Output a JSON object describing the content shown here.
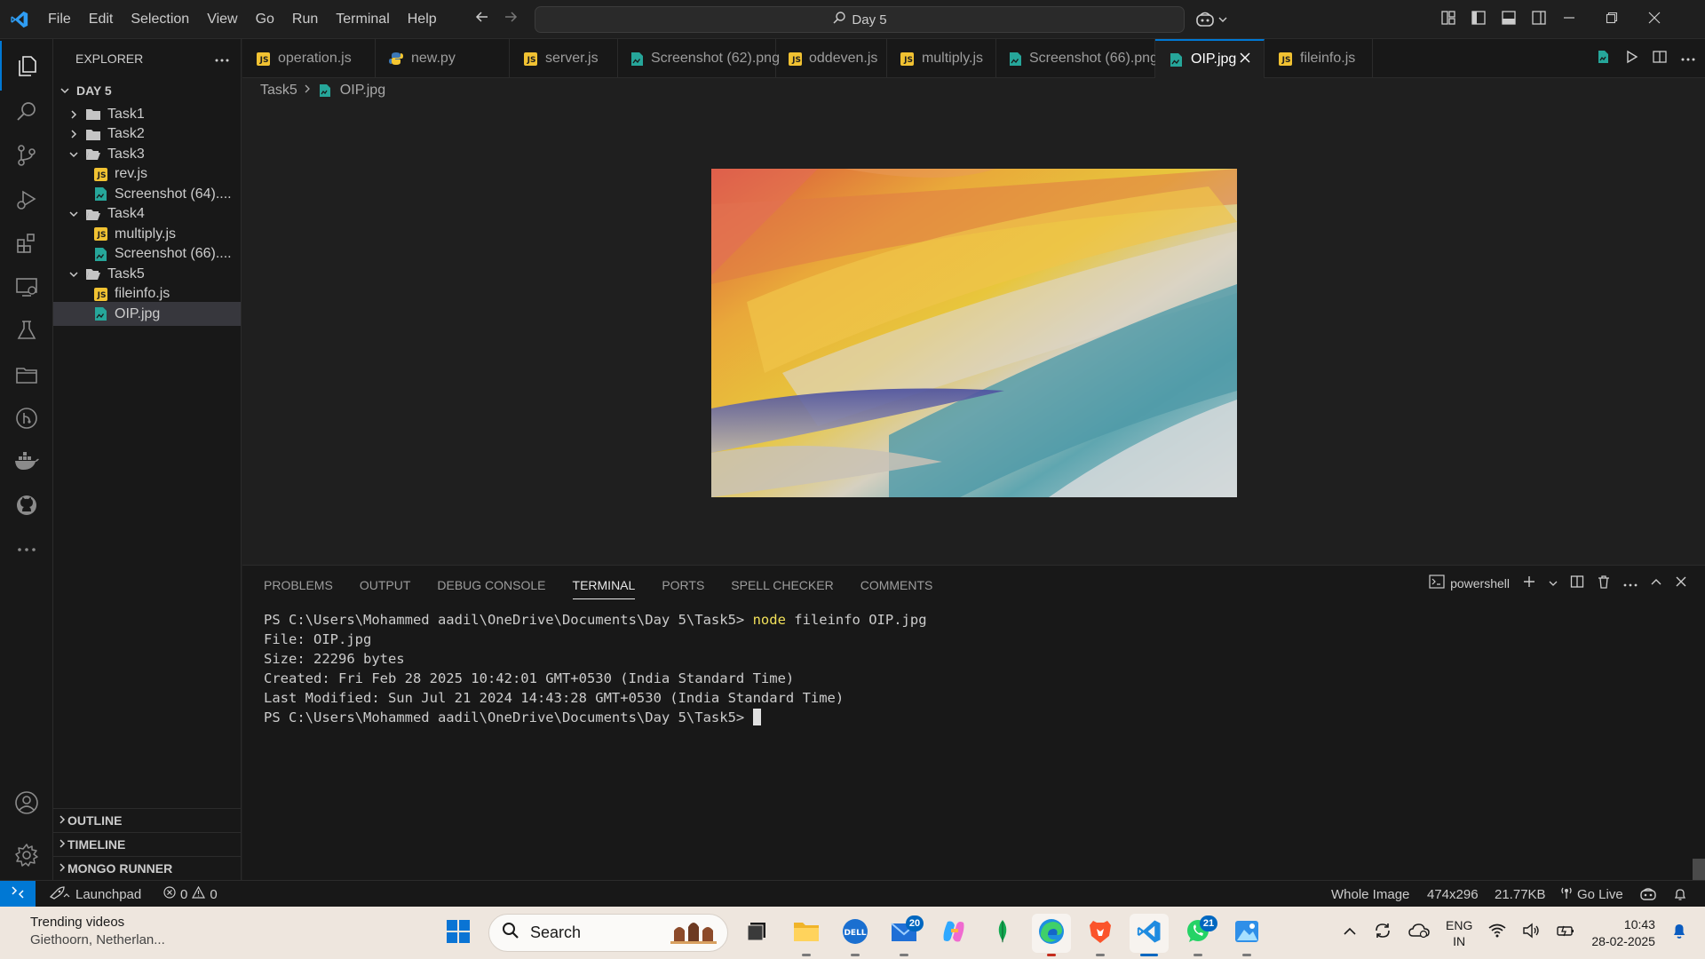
{
  "titlebar": {
    "menu": [
      "File",
      "Edit",
      "Selection",
      "View",
      "Go",
      "Run",
      "Terminal",
      "Help"
    ],
    "search_text": "Day 5"
  },
  "sidebar": {
    "header": "EXPLORER",
    "root": "DAY 5",
    "tree": [
      {
        "label": "Task1",
        "type": "folder",
        "expanded": false,
        "depth": 1
      },
      {
        "label": "Task2",
        "type": "folder",
        "expanded": false,
        "depth": 1
      },
      {
        "label": "Task3",
        "type": "folder",
        "expanded": true,
        "depth": 1
      },
      {
        "label": "rev.js",
        "type": "js",
        "depth": 2
      },
      {
        "label": "Screenshot (64)....",
        "type": "image",
        "depth": 2
      },
      {
        "label": "Task4",
        "type": "folder",
        "expanded": true,
        "depth": 1
      },
      {
        "label": "multiply.js",
        "type": "js",
        "depth": 2
      },
      {
        "label": "Screenshot (66)....",
        "type": "image",
        "depth": 2
      },
      {
        "label": "Task5",
        "type": "folder",
        "expanded": true,
        "depth": 1
      },
      {
        "label": "fileinfo.js",
        "type": "js",
        "depth": 2
      },
      {
        "label": "OIP.jpg",
        "type": "image",
        "depth": 2,
        "selected": true
      }
    ],
    "sections": [
      "OUTLINE",
      "TIMELINE",
      "MONGO RUNNER"
    ]
  },
  "tabs": [
    {
      "label": "operation.js",
      "type": "js"
    },
    {
      "label": "new.py",
      "type": "py"
    },
    {
      "label": "server.js",
      "type": "js"
    },
    {
      "label": "Screenshot (62).png",
      "type": "image"
    },
    {
      "label": "oddeven.js",
      "type": "js"
    },
    {
      "label": "multiply.js",
      "type": "js"
    },
    {
      "label": "Screenshot (66).png",
      "type": "image"
    },
    {
      "label": "OIP.jpg",
      "type": "image",
      "active": true
    },
    {
      "label": "fileinfo.js",
      "type": "js"
    }
  ],
  "breadcrumb": {
    "folder": "Task5",
    "file": "OIP.jpg"
  },
  "panel": {
    "tabs": [
      "PROBLEMS",
      "OUTPUT",
      "DEBUG CONSOLE",
      "TERMINAL",
      "PORTS",
      "SPELL CHECKER",
      "COMMENTS"
    ],
    "active_tab": "TERMINAL",
    "shell": "powershell"
  },
  "terminal": {
    "prompt": "PS C:\\Users\\Mohammed aadil\\OneDrive\\Documents\\Day 5\\Task5> ",
    "command_node": "node",
    "command_rest": " fileinfo OIP.jpg",
    "output": [
      "File: OIP.jpg",
      "Size: 22296 bytes",
      "Created: Fri Feb 28 2025 10:42:01 GMT+0530 (India Standard Time)",
      "Last Modified: Sun Jul 21 2024 14:43:28 GMT+0530 (India Standard Time)"
    ],
    "prompt2": "PS C:\\Users\\Mohammed aadil\\OneDrive\\Documents\\Day 5\\Task5> "
  },
  "statusbar": {
    "launchpad": "Launchpad",
    "errors": "0",
    "warnings": "0",
    "whole_image": "Whole Image",
    "dimensions": "474x296",
    "filesize": "21.77KB",
    "go_live": "Go Live"
  },
  "taskbar": {
    "weather_title": "Trending videos",
    "weather_sub": "Giethoorn, Netherlan...",
    "search": "Search",
    "mail_badge": "20",
    "whatsapp_badge": "21",
    "lang1": "ENG",
    "lang2": "IN",
    "time": "10:43",
    "date": "28-02-2025"
  },
  "colors": {
    "accent": "#0078d4",
    "js_icon": "#f1c232",
    "image_icon": "#26a69a",
    "node_command": "#f1e05a"
  }
}
